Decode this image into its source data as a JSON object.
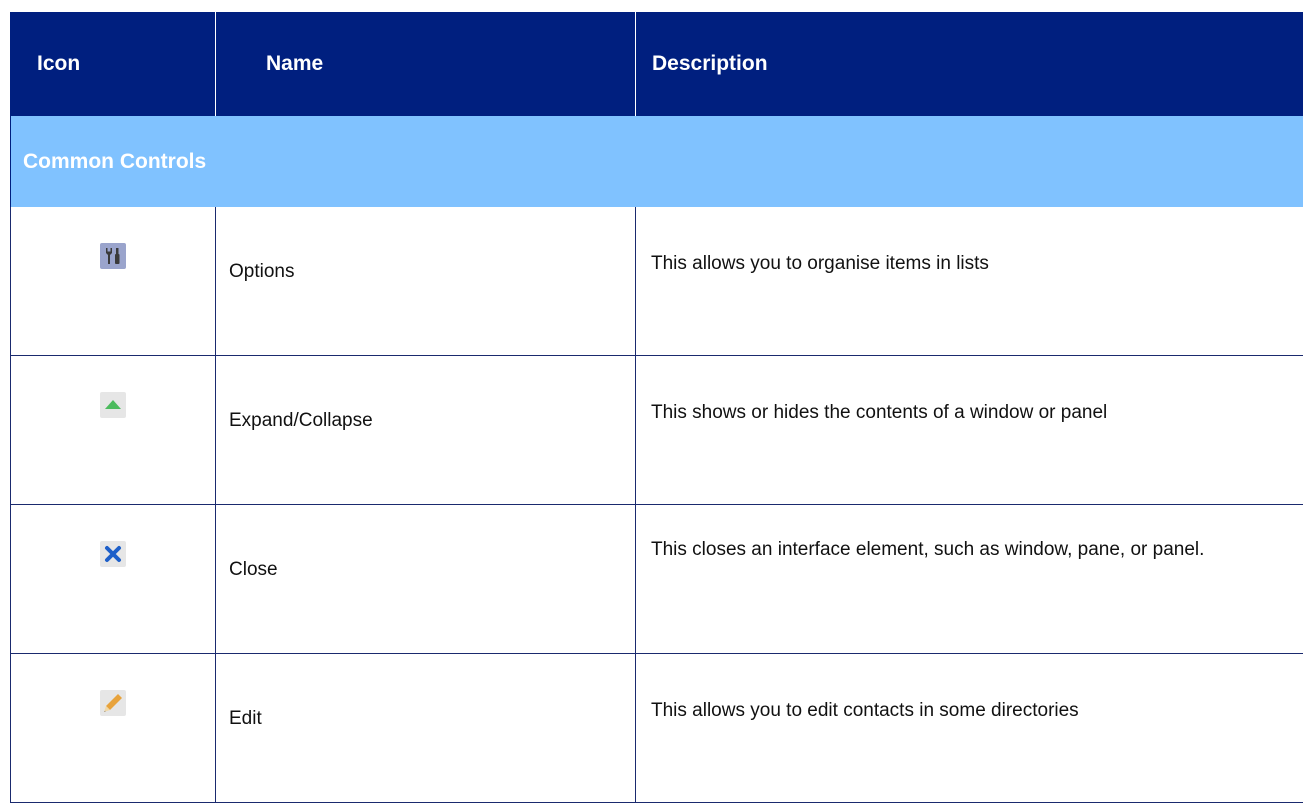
{
  "table": {
    "headers": {
      "icon": "Icon",
      "name": "Name",
      "description": "Description"
    },
    "section_title": "Common Controls",
    "rows": [
      {
        "icon": "options-icon",
        "name": "Options",
        "description": "This allows you to organise items in lists"
      },
      {
        "icon": "expand-collapse-icon",
        "name": "Expand/Collapse",
        "description": "This shows or hides the contents of a window or panel"
      },
      {
        "icon": "close-icon",
        "name": "Close",
        "description": "This closes an interface element, such as window, pane, or panel."
      },
      {
        "icon": "pencil-icon",
        "name": "Edit",
        "description": "This allows you to edit contacts in some directories"
      }
    ]
  },
  "colors": {
    "header_bg": "#001f7f",
    "section_bg": "#80c2ff",
    "border": "#1a2a6e"
  }
}
